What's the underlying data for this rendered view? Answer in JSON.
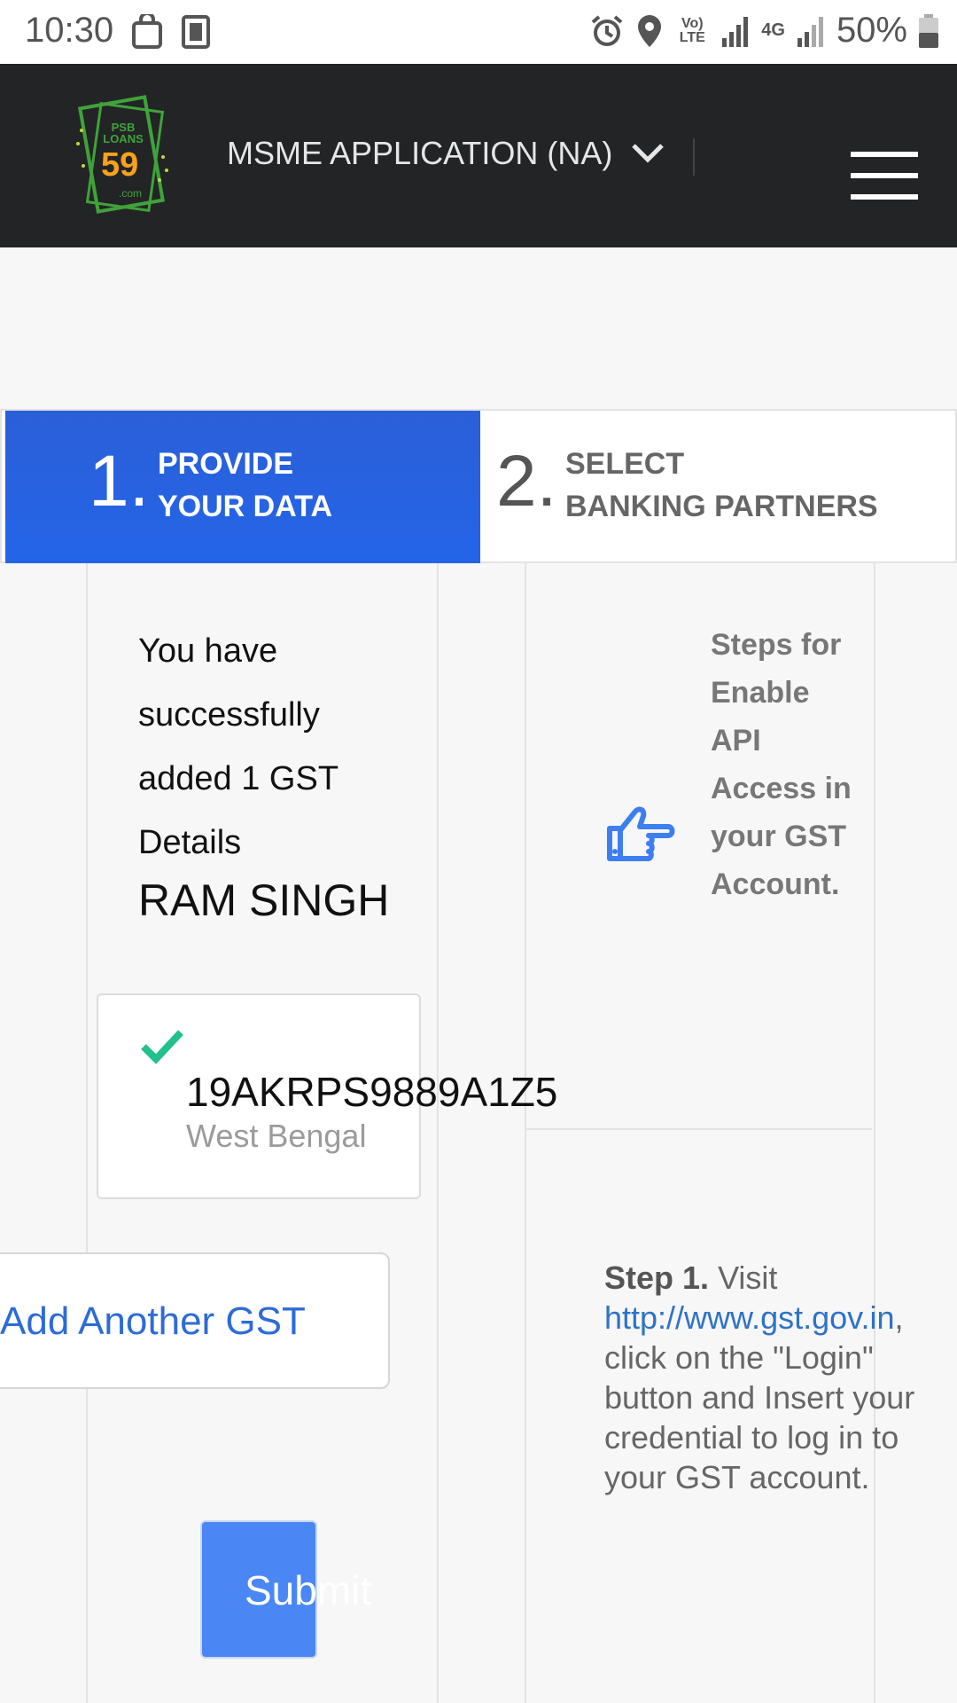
{
  "status_bar": {
    "time": "10:30",
    "battery": "50%",
    "icons": [
      "bag-icon",
      "sim-icon",
      "alarm-icon",
      "location-icon",
      "volte-icon",
      "signal-icon",
      "4g-icon",
      "signal-icon",
      "battery-icon"
    ],
    "volte_label": "Vo) LTE",
    "network_label": "4G"
  },
  "header": {
    "logo_text_top": "PSB LOANS",
    "logo_number": "59",
    "logo_suffix": ".com",
    "app_title": "MSME APPLICATION (NA)",
    "menu_icon": "hamburger-icon"
  },
  "stepper": {
    "step1": {
      "number": "1.",
      "line1": "PROVIDE",
      "line2": "YOUR DATA"
    },
    "step2": {
      "number": "2.",
      "line1": "SELECT",
      "line2": "BANKING PARTNERS"
    }
  },
  "main": {
    "success_message": "You have successfully added 1 GST Details",
    "owner_name": "RAM SINGH",
    "gst_card": {
      "gstin": "19AKRPS9889A1Z5",
      "state": "West Bengal"
    },
    "add_gst_label": "Add Another GST",
    "submit_label": "Submit"
  },
  "help": {
    "heading": "Steps for Enable API Access in your GST Account.",
    "step1_label": "Step 1.",
    "step1_prefix": "Visit",
    "step1_link": "http://www.gst.gov.in",
    "step1_rest": ", click on the \"Login\" button and Insert your credential to log in to your GST account."
  },
  "colors": {
    "header_bg": "#232426",
    "step_active": "#2465e8",
    "button_blue": "#4a87f4",
    "link": "#2e72c8",
    "success_check": "#22c08a"
  }
}
